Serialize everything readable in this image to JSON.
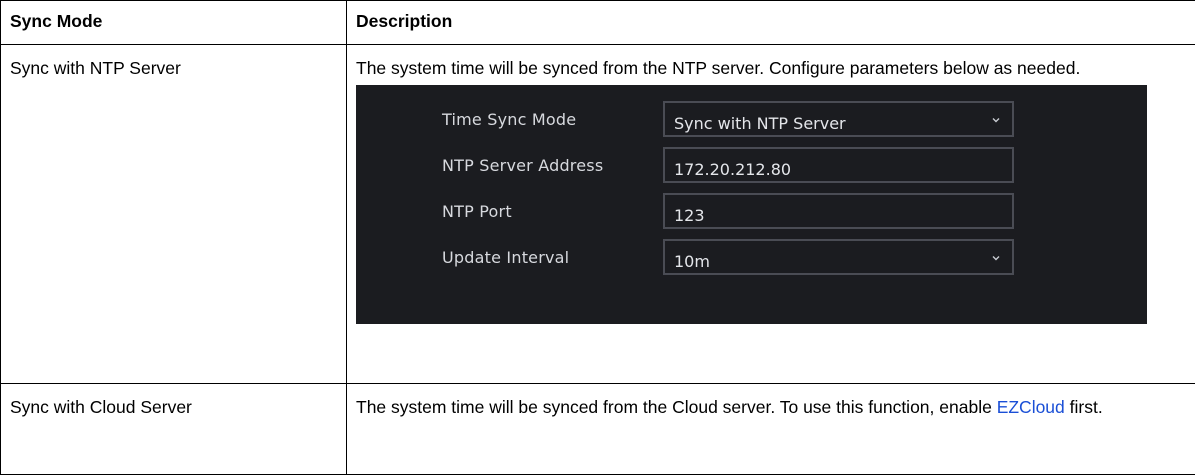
{
  "table": {
    "headers": [
      "Sync Mode",
      "Description"
    ],
    "rows": [
      {
        "mode": "Sync with NTP Server",
        "description": "The system time will be synced from the NTP server. Configure parameters below as needed."
      },
      {
        "mode": "Sync with Cloud Server",
        "description_before": "The system time will be synced from the Cloud server. To use this function, enable ",
        "link": "EZCloud",
        "description_after": " first."
      }
    ]
  },
  "settings_panel": {
    "fields": [
      {
        "label": "Time Sync Mode",
        "value": "Sync with NTP Server",
        "type": "select"
      },
      {
        "label": "NTP Server Address",
        "value": "172.20.212.80",
        "type": "input"
      },
      {
        "label": "NTP Port",
        "value": "123",
        "type": "input"
      },
      {
        "label": "Update Interval",
        "value": "10m",
        "type": "select"
      }
    ]
  },
  "colors": {
    "panel_background": "#1b1c20",
    "field_border": "#4a4c54",
    "link": "#1a4fd6"
  }
}
